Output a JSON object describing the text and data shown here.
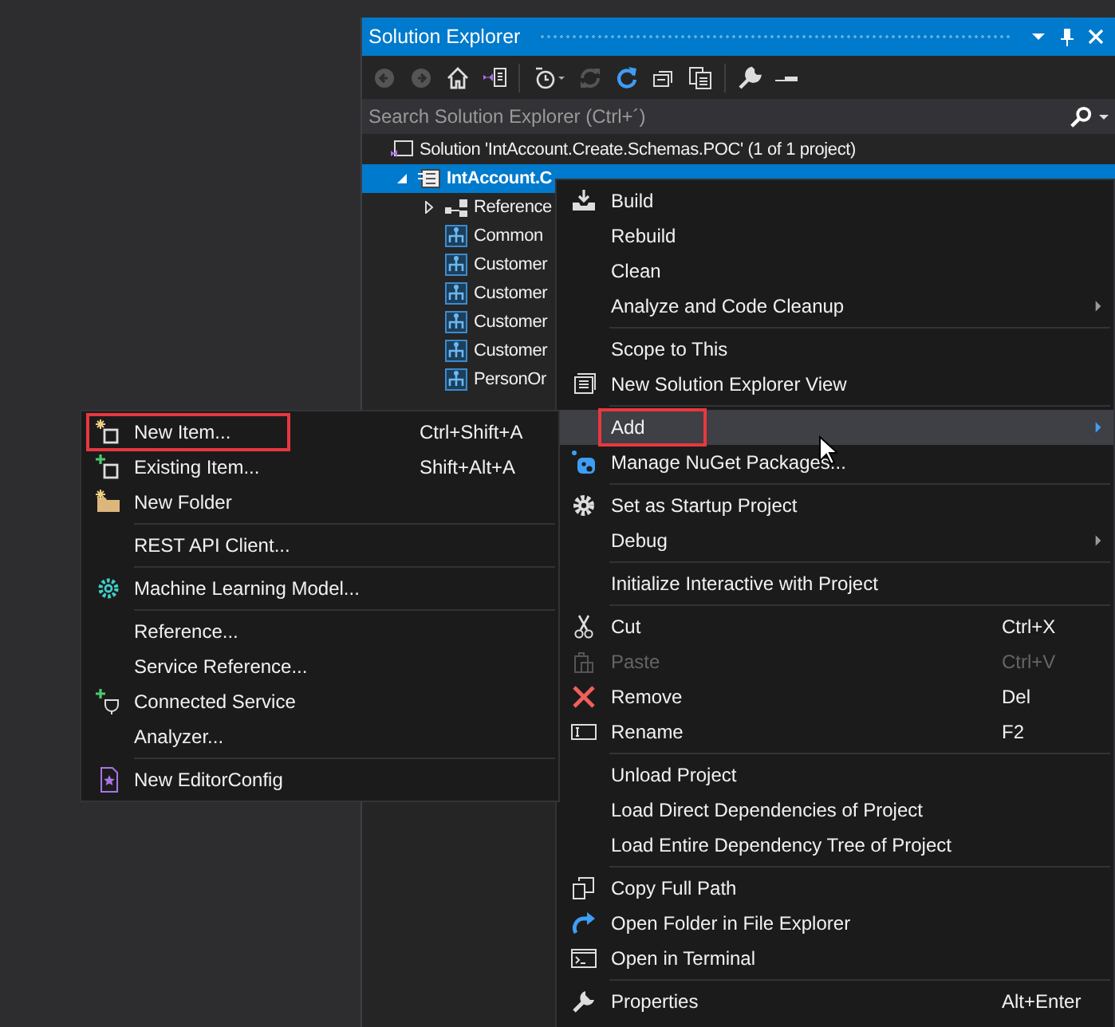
{
  "panel": {
    "title": "Solution Explorer",
    "search": {
      "placeholder": "Search Solution Explorer (Ctrl+´)"
    }
  },
  "tree": [
    {
      "label": "Solution 'IntAccount.Create.Schemas.POC' (1 of 1 project)",
      "selected": false,
      "children": [
        {
          "label": "IntAccount.C",
          "selected": true,
          "expanded": true,
          "children": [
            {
              "label": "Reference",
              "selected": false,
              "expanded": false
            },
            {
              "label": "Common",
              "selected": false
            },
            {
              "label": "Customer",
              "selected": false
            },
            {
              "label": "Customer",
              "selected": false
            },
            {
              "label": "Customer",
              "selected": false
            },
            {
              "label": "Customer",
              "selected": false
            },
            {
              "label": "PersonOr",
              "selected": false
            }
          ]
        }
      ]
    }
  ],
  "context_menu": {
    "items": [
      {
        "kind": "item",
        "label": "Build",
        "selected": false,
        "disabled": false,
        "submenu": false,
        "outlined": false
      },
      {
        "kind": "item",
        "label": "Rebuild",
        "selected": false,
        "disabled": false,
        "submenu": false,
        "outlined": false
      },
      {
        "kind": "item",
        "label": "Clean",
        "selected": false,
        "disabled": false,
        "submenu": false,
        "outlined": false
      },
      {
        "kind": "item",
        "label": "Analyze and Code Cleanup",
        "selected": false,
        "disabled": false,
        "submenu": true,
        "outlined": false
      },
      {
        "kind": "separator"
      },
      {
        "kind": "item",
        "label": "Scope to This",
        "selected": false,
        "disabled": false,
        "submenu": false,
        "outlined": false
      },
      {
        "kind": "item",
        "label": "New Solution Explorer View",
        "selected": false,
        "disabled": false,
        "submenu": false,
        "outlined": false
      },
      {
        "kind": "separator"
      },
      {
        "kind": "item",
        "label": "Add",
        "selected": true,
        "disabled": false,
        "submenu": true,
        "outlined": true
      },
      {
        "kind": "item",
        "label": "Manage NuGet Packages...",
        "selected": false,
        "disabled": false,
        "submenu": false,
        "outlined": false
      },
      {
        "kind": "separator"
      },
      {
        "kind": "item",
        "label": "Set as Startup Project",
        "selected": false,
        "disabled": false,
        "submenu": false,
        "outlined": false
      },
      {
        "kind": "item",
        "label": "Debug",
        "selected": false,
        "disabled": false,
        "submenu": true,
        "outlined": false
      },
      {
        "kind": "separator"
      },
      {
        "kind": "item",
        "label": "Initialize Interactive with Project",
        "selected": false,
        "disabled": false,
        "submenu": false,
        "outlined": false
      },
      {
        "kind": "separator"
      },
      {
        "kind": "item",
        "label": "Cut",
        "shortcut": "Ctrl+X",
        "selected": false,
        "disabled": false,
        "submenu": false,
        "outlined": false
      },
      {
        "kind": "item",
        "label": "Paste",
        "shortcut": "Ctrl+V",
        "selected": false,
        "disabled": true,
        "submenu": false,
        "outlined": false
      },
      {
        "kind": "item",
        "label": "Remove",
        "shortcut": "Del",
        "selected": false,
        "disabled": false,
        "submenu": false,
        "outlined": false
      },
      {
        "kind": "item",
        "label": "Rename",
        "shortcut": "F2",
        "selected": false,
        "disabled": false,
        "submenu": false,
        "outlined": false
      },
      {
        "kind": "separator"
      },
      {
        "kind": "item",
        "label": "Unload Project",
        "selected": false,
        "disabled": false,
        "submenu": false,
        "outlined": false
      },
      {
        "kind": "item",
        "label": "Load Direct Dependencies of Project",
        "selected": false,
        "disabled": false,
        "submenu": false,
        "outlined": false
      },
      {
        "kind": "item",
        "label": "Load Entire Dependency Tree of Project",
        "selected": false,
        "disabled": false,
        "submenu": false,
        "outlined": false
      },
      {
        "kind": "separator"
      },
      {
        "kind": "item",
        "label": "Copy Full Path",
        "selected": false,
        "disabled": false,
        "submenu": false,
        "outlined": false
      },
      {
        "kind": "item",
        "label": "Open Folder in File Explorer",
        "selected": false,
        "disabled": false,
        "submenu": false,
        "outlined": false
      },
      {
        "kind": "item",
        "label": "Open in Terminal",
        "selected": false,
        "disabled": false,
        "submenu": false,
        "outlined": false
      },
      {
        "kind": "separator"
      },
      {
        "kind": "item",
        "label": "Properties",
        "shortcut": "Alt+Enter",
        "selected": false,
        "disabled": false,
        "submenu": false,
        "outlined": false
      }
    ]
  },
  "add_submenu": {
    "items": [
      {
        "kind": "item",
        "label": "New Item...",
        "shortcut": "Ctrl+Shift+A",
        "selected": false,
        "disabled": false,
        "outlined": true
      },
      {
        "kind": "item",
        "label": "Existing Item...",
        "shortcut": "Shift+Alt+A",
        "selected": false,
        "disabled": false,
        "outlined": false
      },
      {
        "kind": "item",
        "label": "New Folder",
        "selected": false,
        "disabled": false,
        "outlined": false
      },
      {
        "kind": "separator"
      },
      {
        "kind": "item",
        "label": "REST API Client...",
        "selected": false,
        "disabled": false,
        "outlined": false
      },
      {
        "kind": "separator"
      },
      {
        "kind": "item",
        "label": "Machine Learning Model...",
        "selected": false,
        "disabled": false,
        "outlined": false
      },
      {
        "kind": "separator"
      },
      {
        "kind": "item",
        "label": "Reference...",
        "selected": false,
        "disabled": false,
        "outlined": false
      },
      {
        "kind": "item",
        "label": "Service Reference...",
        "selected": false,
        "disabled": false,
        "outlined": false
      },
      {
        "kind": "item",
        "label": "Connected Service",
        "selected": false,
        "disabled": false,
        "outlined": false
      },
      {
        "kind": "item",
        "label": "Analyzer...",
        "selected": false,
        "disabled": false,
        "outlined": false
      },
      {
        "kind": "separator"
      },
      {
        "kind": "item",
        "label": "New EditorConfig",
        "selected": false,
        "disabled": false,
        "outlined": false
      }
    ]
  }
}
